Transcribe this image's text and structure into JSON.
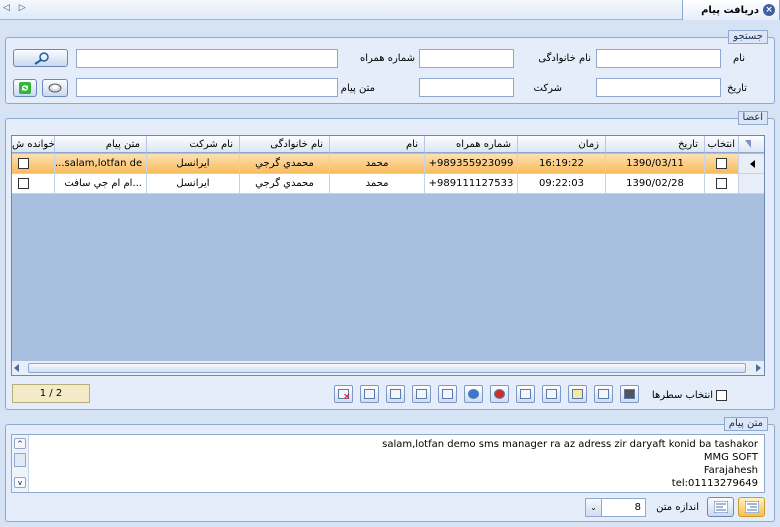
{
  "window": {
    "title": "دریافت پیام",
    "nav": "◁ ▷"
  },
  "search": {
    "legend": "جستجو",
    "first_name_label": "نام",
    "last_name_label": "نام خانوادگی",
    "mobile_label": "شماره همراه",
    "date_label": "تاریخ",
    "company_label": "شرکت",
    "message_text_label": "متن پیام"
  },
  "members": {
    "legend": "اعضا",
    "columns": [
      "انتخاب",
      "تاریخ",
      "زمان",
      "شماره همراه",
      "نام",
      "نام خانوادگی",
      "نام شرکت",
      "متن پیام",
      "خوانده ش"
    ],
    "rows": [
      {
        "date": "1390/03/11",
        "time": "16:19:22",
        "mobile": "+989355923099",
        "first_name": "محمد",
        "last_name": "محمدي گرجي",
        "company": "ايرانسل",
        "message": "...salam,lotfan de"
      },
      {
        "date": "1390/02/28",
        "time": "09:22:03",
        "mobile": "+989111127533",
        "first_name": "محمد",
        "last_name": "محمدي گرجي",
        "company": "ايرانسل",
        "message": "ام ام جي سافت..."
      }
    ],
    "pager": "1 / 2",
    "select_rows_label": "انتخاب سطرها"
  },
  "message": {
    "legend": "متن پیام",
    "lines": [
      "salam,lotfan demo sms manager ra az adress zir daryaft konid ba tashakor",
      "MMG SOFT",
      "Farajahesh",
      "tel:01113279649"
    ],
    "font_size_label": "اندازه متن",
    "font_size_value": "8"
  },
  "colors": {
    "selected_row": "#f9b957",
    "accent": "#3e5fa0"
  }
}
